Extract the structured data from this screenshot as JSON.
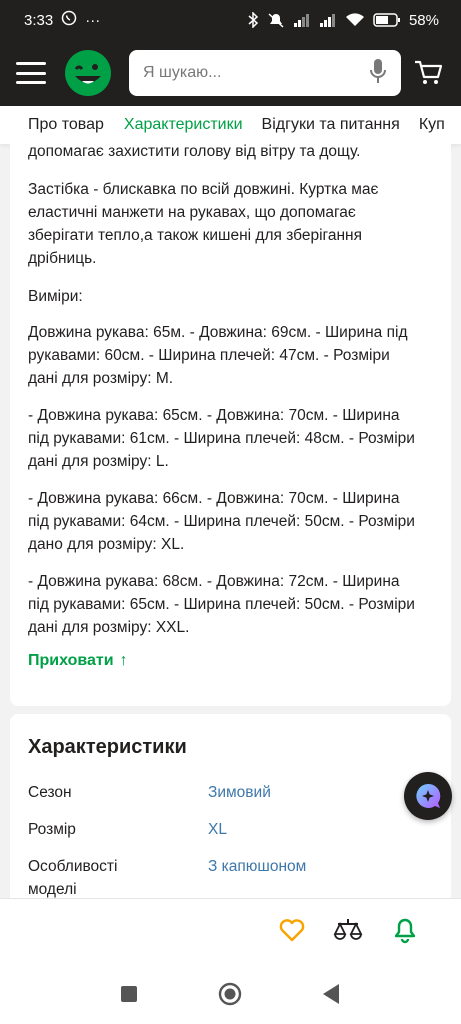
{
  "status": {
    "time": "3:33",
    "dots": "···",
    "battery": "58%"
  },
  "search": {
    "placeholder": "Я шукаю..."
  },
  "tabs": [
    "Про товар",
    "Характеристики",
    "Відгуки та питання",
    "Куп"
  ],
  "description": {
    "cut_line": "допомагає захистити голову від вітру та дощу.",
    "zip": "Застібка - блискавка по всій довжині. Куртка має еластичні манжети на рукавах, що допомагає зберігати тепло,а також кишені для зберігання дрібниць.",
    "measures_title": "Виміри:",
    "m": "Довжина рукава: 65м. - Довжина: 69см. - Ширина під рукавами: 60см. - Ширина плечей: 47см. - Розміри дані для розміру: M.",
    "l": "- Довжина рукава: 65см. - Довжина: 70см. - Ширина під рукавами: 61см. - Ширина плечей: 48см. - Розміри дані для розміру: L.",
    "xl": "- Довжина рукава: 66см. - Довжина: 70см. - Ширина під рукавами: 64см. - Ширина плечей: 50см. - Розміри дано для розміру: XL.",
    "xxl": "- Довжина рукава: 68см. - Довжина: 72см. - Ширина під рукавами: 65см. - Ширина плечей: 50см. - Розміри дані для розміру: XXL.",
    "hide_label": "Приховати",
    "hide_arrow": "↑"
  },
  "characteristics": {
    "title": "Характеристики",
    "rows": [
      {
        "label": "Сезон",
        "value": "Зимовий"
      },
      {
        "label": "Розмір",
        "value": "XL"
      },
      {
        "label": "Особливості моделі",
        "value": "З капюшоном"
      }
    ]
  },
  "colors": {
    "accent": "#00a046",
    "dark": "#221f1f",
    "link": "#3e77aa",
    "heart": "#f8a300"
  },
  "icons": [
    "whatsapp-like-icon",
    "bluetooth-icon",
    "mute-icon",
    "signal-icon",
    "wifi-icon",
    "battery-icon",
    "menu-icon",
    "rozetka-logo",
    "mic-icon",
    "cart-icon",
    "chat-bot-icon",
    "heart-icon",
    "compare-icon",
    "bell-icon",
    "recent-apps-icon",
    "home-icon",
    "back-icon"
  ]
}
